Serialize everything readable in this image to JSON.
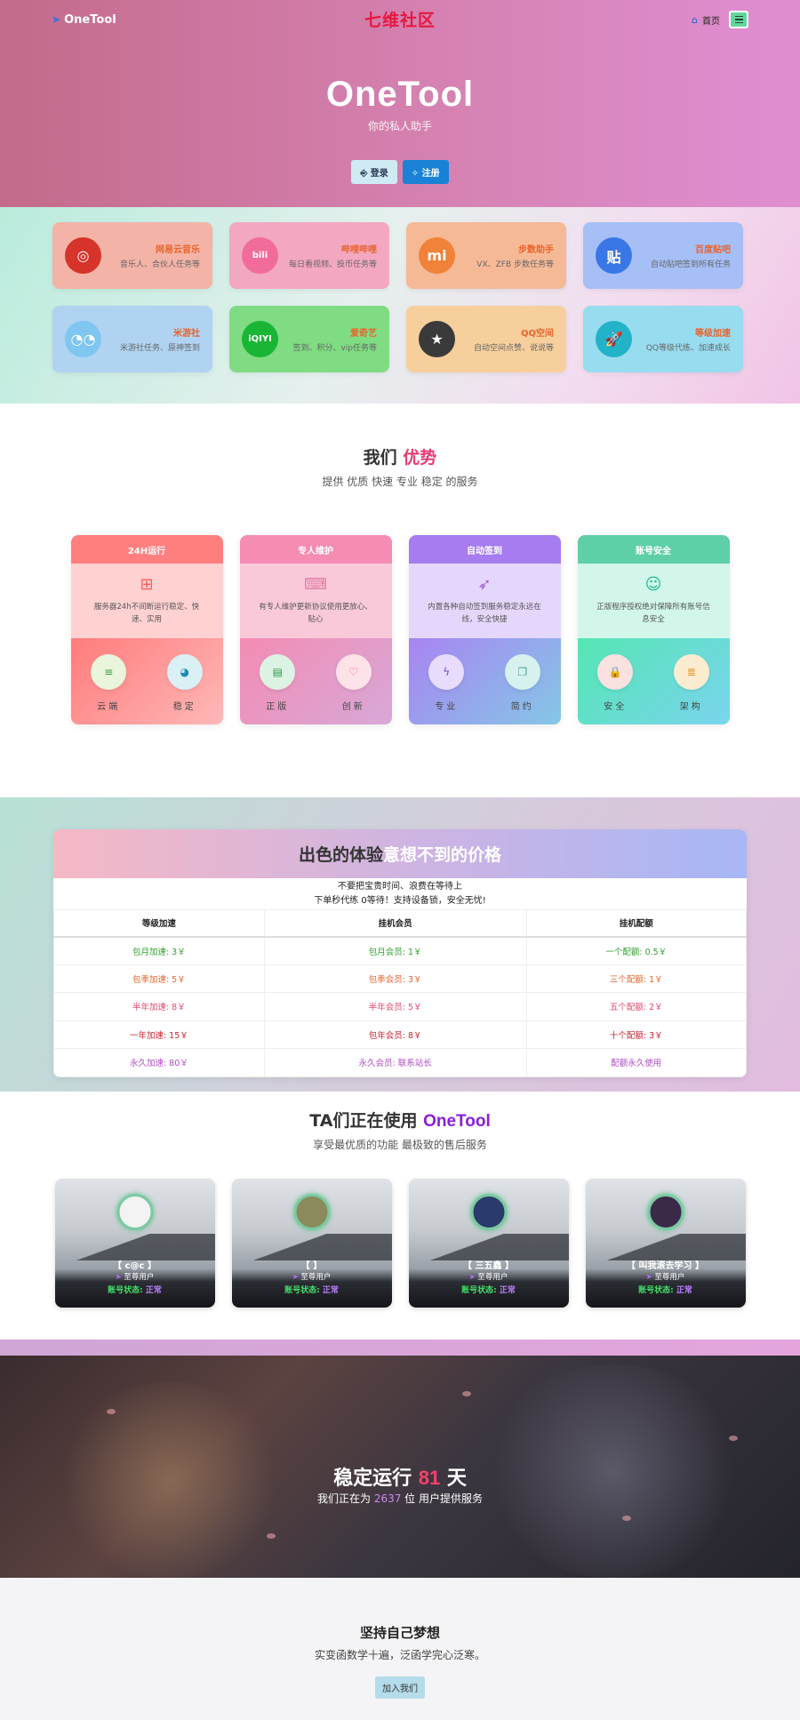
{
  "nav": {
    "brand": "OneTool",
    "site_title": "七维社区",
    "home_label": "首页"
  },
  "hero": {
    "title": "OneTool",
    "subtitle": "你的私人助手",
    "login_label": "登录",
    "register_label": "注册"
  },
  "apps": [
    {
      "name": "网易云音乐",
      "desc": "音乐人、合伙人任务等",
      "icon": "netease-music-icon",
      "glyph": "◎",
      "bg": "#f3b4a7",
      "iconbg": "#d6332a"
    },
    {
      "name": "哔哩哔哩",
      "desc": "每日看视频、投币任务等",
      "icon": "bilibili-icon",
      "glyph": "bili",
      "bg": "#f3a7c0",
      "iconbg": "#f16c9a"
    },
    {
      "name": "步数助手",
      "desc": "VX、ZFB 步数任务等",
      "icon": "mi-icon",
      "glyph": "mi",
      "bg": "#f6b996",
      "iconbg": "#f08239"
    },
    {
      "name": "百度贴吧",
      "desc": "自动贴吧签到所有任务",
      "icon": "tieba-icon",
      "glyph": "贴",
      "bg": "#a6bff6",
      "iconbg": "#3a77e6"
    },
    {
      "name": "米游社",
      "desc": "米游社任务、原神签到",
      "icon": "miyoushe-icon",
      "glyph": "◔◔",
      "bg": "#b0d3f2",
      "iconbg": "#7fc6f0"
    },
    {
      "name": "爱奇艺",
      "desc": "签到、积分、vip任务等",
      "icon": "iqiyi-icon",
      "glyph": "iQIYI",
      "bg": "#7fdc82",
      "iconbg": "#19b534"
    },
    {
      "name": "QQ空间",
      "desc": "自动空间点赞、说说等",
      "icon": "qzone-icon",
      "glyph": "★",
      "bg": "#f7cf9c",
      "iconbg": "#3a3a3a"
    },
    {
      "name": "等级加速",
      "desc": "QQ等级代练、加速成长",
      "icon": "rocket-icon",
      "glyph": "🚀",
      "bg": "#98dcef",
      "iconbg": "#22b3c9"
    }
  ],
  "advantages": {
    "title_a": "我们 ",
    "title_b": "优势",
    "subtitle": "提供 优质 快速 专业 稳定 的服务",
    "cards": [
      {
        "head": "24H运行",
        "text": "服务器24h不间断运行稳定、快速、实用",
        "icon": "windows-icon",
        "glyph": "⊞",
        "iconcolor": "#ff5a5a",
        "headbg": "#ff7f7f",
        "bodybg": "#ffd1d1",
        "footbg": "linear-gradient(135deg,#ff7b7b,#ffb8b8)",
        "feats": [
          {
            "label": "云端",
            "icon": "server-icon",
            "glyph": "≡",
            "color": "#3b9a35",
            "bg": "#e9f6dc"
          },
          {
            "label": "稳定",
            "icon": "globe-icon",
            "glyph": "◕",
            "color": "#1f8bb6",
            "bg": "#d9f0f5"
          }
        ]
      },
      {
        "head": "专人维护",
        "text": "有专人维护更新协议使用更放心、贴心",
        "icon": "keyboard-icon",
        "glyph": "⌨",
        "iconcolor": "#e37aa4",
        "headbg": "#f48cb3",
        "bodybg": "#f9c9d9",
        "footbg": "linear-gradient(135deg,#f38cb3,#d8a8d8)",
        "feats": [
          {
            "label": "正版",
            "icon": "card-icon",
            "glyph": "▤",
            "color": "#2e9a45",
            "bg": "#dcf3e4"
          },
          {
            "label": "创新",
            "icon": "heart-icon",
            "glyph": "♡",
            "color": "#e0486e",
            "bg": "#fde2e8"
          }
        ]
      },
      {
        "head": "自动签到",
        "text": "内置各种自动签到服务稳定永远在线，安全快捷",
        "icon": "rocket-icon",
        "glyph": "➶",
        "iconcolor": "#9a5ae0",
        "headbg": "#a67cf0",
        "bodybg": "#e5d7fb",
        "footbg": "linear-gradient(135deg,#a884f2,#84c7e6)",
        "feats": [
          {
            "label": "专业",
            "icon": "bolt-icon",
            "glyph": "ϟ",
            "color": "#6f4cc4",
            "bg": "#e7dcfb"
          },
          {
            "label": "简约",
            "icon": "copy-icon",
            "glyph": "❐",
            "color": "#3ba59a",
            "bg": "#d7f1ee"
          }
        ]
      },
      {
        "head": "账号安全",
        "text": "正版程序授权绝对保障所有账号信息安全",
        "icon": "user-icon",
        "glyph": "☺",
        "iconcolor": "#1fb58c",
        "headbg": "#5fcfa8",
        "bodybg": "#d2f6ea",
        "footbg": "linear-gradient(135deg,#55e6b3,#7ad4ee)",
        "feats": [
          {
            "label": "安全",
            "icon": "lock-icon",
            "glyph": "🔒",
            "color": "#d33",
            "bg": "#fbe0e0"
          },
          {
            "label": "架构",
            "icon": "layers-icon",
            "glyph": "≣",
            "color": "#e08d1a",
            "bg": "#fbecd0"
          }
        ]
      }
    ]
  },
  "pricing": {
    "title_a": "出色的体验 ",
    "title_b": "意想不到的价格",
    "note1": "不要把宝贵时间、浪费在等待上",
    "note2": "下单秒代练 0等待！支持设备锁，安全无忧!",
    "headers": [
      "等级加速",
      "挂机会员",
      "挂机配额"
    ],
    "rows": [
      {
        "cls": "c-green",
        "cells": [
          "包月加速: 3￥",
          "包月会员: 1￥",
          "一个配额: 0.5￥"
        ]
      },
      {
        "cls": "c-orange",
        "cells": [
          "包季加速: 5￥",
          "包季会员: 3￥",
          "三个配额: 1￥"
        ]
      },
      {
        "cls": "c-pink",
        "cells": [
          "半年加速: 8￥",
          "半年会员: 5￥",
          "五个配额: 2￥"
        ]
      },
      {
        "cls": "c-red",
        "cells": [
          "一年加速: 15￥",
          "包年会员: 8￥",
          "十个配额: 3￥"
        ]
      },
      {
        "cls": "c-purple",
        "cells": [
          "永久加速: 80￥",
          "永久会员: 联系站长",
          "配额永久使用"
        ]
      }
    ]
  },
  "users": {
    "title_a": "TA们正在使用 ",
    "title_b": "OneTool",
    "subtitle": "享受最优质的功能 最极致的售后服务",
    "list": [
      {
        "name": "【 c@c 】",
        "role": "至尊用户",
        "status_label": "账号状态:",
        "status": "正常",
        "avatar_color": "#f3f3f3"
      },
      {
        "name": "【 】",
        "role": "至尊用户",
        "status_label": "账号状态:",
        "status": "正常",
        "avatar_color": "#8a8a5a"
      },
      {
        "name": "【 三五鑫 】",
        "role": "至尊用户",
        "status_label": "账号状态:",
        "status": "正常",
        "avatar_color": "#2a3a6a"
      },
      {
        "name": "【 叫我滚去学习 】",
        "role": "至尊用户",
        "status_label": "账号状态:",
        "status": "正常",
        "avatar_color": "#3a2a4a"
      }
    ]
  },
  "banner": {
    "title_a": "稳定运行 ",
    "days": "81",
    "title_b": " 天",
    "sub_a": "我们正在为 ",
    "user_count": "2637",
    "sub_b": " 位 用户提供服务"
  },
  "cta": {
    "title": "坚持自己梦想",
    "subtitle": "实变函数学十遍，泛函学完心泛寒。",
    "button": "加入我们"
  }
}
